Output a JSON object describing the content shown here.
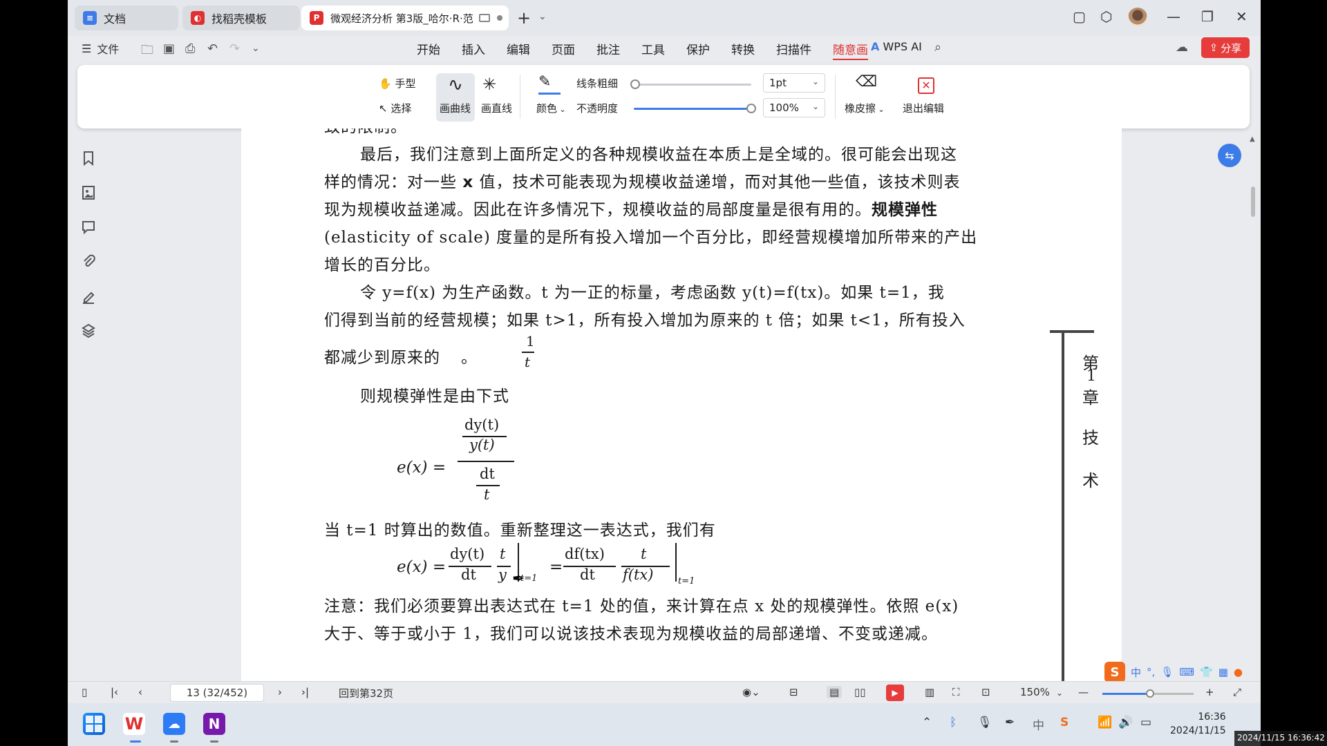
{
  "tabs": [
    {
      "label": "文档",
      "icon": "doc-icon",
      "color": "#3d7be8"
    },
    {
      "label": "找稻壳模板",
      "icon": "docer-icon",
      "color": "#e03131"
    },
    {
      "label": "微观经济分析  第3版_哈尔·R·范",
      "icon": "pdf-icon",
      "color": "#e03131"
    }
  ],
  "menu": {
    "file_label": "文件",
    "items": [
      "开始",
      "插入",
      "编辑",
      "页面",
      "批注",
      "工具",
      "保护",
      "转换",
      "扫描件",
      "随意画"
    ],
    "active": "随意画",
    "wps_ai": "WPS AI",
    "share": "分享"
  },
  "toolbar": {
    "hand": "手型",
    "select": "选择",
    "draw_curve": "画曲线",
    "draw_line": "画直线",
    "color": "颜色",
    "line_width_label": "线条粗细",
    "opacity_label": "不透明度",
    "line_width_value": "1pt",
    "opacity_value": "100%",
    "eraser": "橡皮擦",
    "exit_edit": "退出编辑",
    "accent": "#3d7be8"
  },
  "document": {
    "lines": {
      "l0": "致的限制。",
      "l1": "最后，我们注意到上面所定义的各种规模收益在本质上是全域的。很可能会出现这",
      "l2a": "样的情况：对一些 ",
      "l2b": "x",
      "l2c": " 值，技术可能表现为规模收益递增，而对其他一些值，该技术则表",
      "l3a": "现为规模收益递减。因此在许多情况下，规模收益的局部度量是很有用的。",
      "l3b": "规模弹性",
      "l4": "(elasticity of scale) 度量的是所有投入增加一个百分比，即经营规模增加所带来的产出",
      "l5": "增长的百分比。",
      "l6": "令 y=f(x) 为生产函数。t 为一正的标量，考虑函数 y(t)=f(tx)。如果 t=1，我",
      "l7": "们得到当前的经营规模；如果 t>1，所有投入增加为原来的 t 倍；如果 t<1，所有投入",
      "l8a": "都减少到原来的",
      "l8b": "。",
      "l9": "则规模弹性是由下式",
      "l10": "当 t=1 时算出的数值。重新整理这一表达式，我们有",
      "l11": "注意：我们必须要算出表达式在 t=1 处的值，来计算在点 x 处的规模弹性。依照 e(x)",
      "l12": "大于、等于或小于 1，我们可以说该技术表现为规模收益的局部递增、不变或递减。"
    },
    "eq1": {
      "lhs": "e(x) =",
      "num_top": "dy(t)",
      "num_bottom": "y(t)",
      "den_top": "dt",
      "den_bottom": "t"
    },
    "eq2": {
      "lhs": "e(x) =",
      "f1_num": "dy(t)",
      "f1_den": "dt",
      "f2_num": "t",
      "f2_den": "y",
      "sub1": "t=1",
      "eq": "=",
      "f3_num": "df(tx)",
      "f3_den": "dt",
      "f4_num": "t",
      "f4_den": "f(tx)",
      "sub2": "t=1"
    },
    "frac_one": "1",
    "frac_t": "t",
    "chapter": [
      "第",
      "1",
      "章",
      "技",
      "术"
    ]
  },
  "status": {
    "page": "13 (32/452)",
    "back_to": "回到第32页",
    "zoom": "150%",
    "zoom_fraction": 0.5
  },
  "taskbar": {
    "time": "16:36",
    "date": "2024/11/15",
    "ime_lang": "中",
    "tray_lang": "中"
  },
  "overlay_timestamp": "2024/11/15 16:36:42"
}
